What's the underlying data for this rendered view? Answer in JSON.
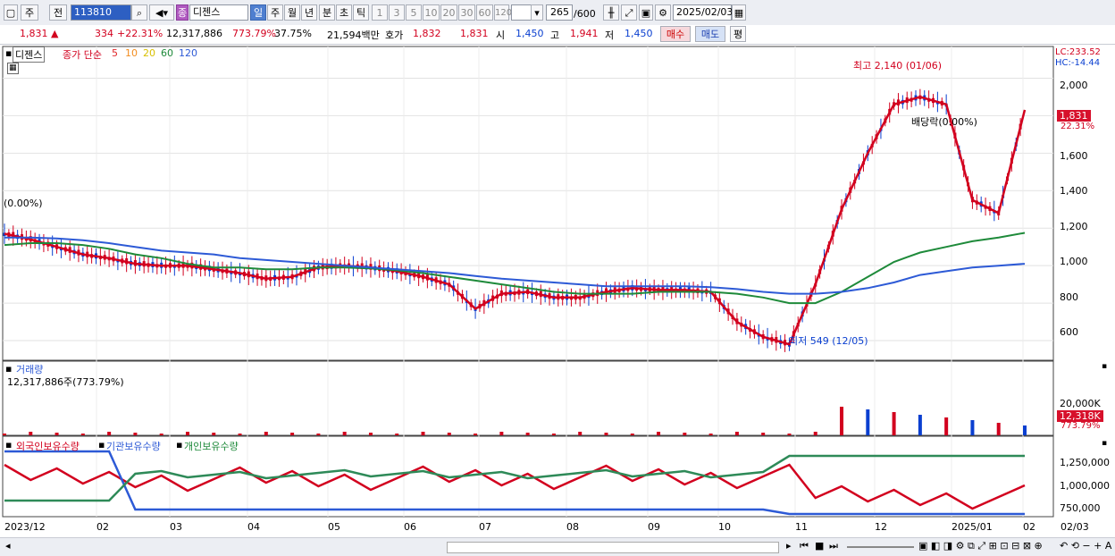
{
  "toolbar": {
    "period_ju": "주",
    "jeon": "전",
    "code": "113810",
    "name_badge": "종",
    "name": "디젠스",
    "periods": [
      "일",
      "주",
      "월",
      "년",
      "분",
      "초",
      "틱"
    ],
    "mins": [
      "1",
      "3",
      "5",
      "10",
      "20",
      "30",
      "60",
      "120"
    ],
    "count": "265",
    "count_max": "/600",
    "date": "2025/02/03"
  },
  "quote": {
    "price": "1,831 ▲",
    "change": "334",
    "change_pct": "+22.31%",
    "volume": "12,317,886",
    "vol_pct": "773.79%",
    "turnover": "37.75%",
    "amount": "21,594백만",
    "hoga_label": "호가",
    "hoga_sell": "1,832",
    "hoga_buy": "1,831",
    "open_label": "시",
    "open": "1,450",
    "high_label": "고",
    "high": "1,941",
    "low_label": "저",
    "low": "1,450",
    "buy_btn": "매수",
    "sell_btn": "매도",
    "eval_btn": "평"
  },
  "price_panel": {
    "name": "디젠스",
    "ma_label": "종가 단순",
    "ma_periods": [
      "5",
      "10",
      "20",
      "60",
      "120"
    ],
    "ma_colors": [
      "#e0262a",
      "#f28c1e",
      "#f0d81c",
      "#1e8a3a",
      "#2d5ad6"
    ],
    "lc": "LC:233.52",
    "hc": "HC:-14.44",
    "zero_pct": "(0.00%)",
    "high_note": "최고 2,140 (01/06)",
    "low_note": "최저 549 (12/05)",
    "div_note": "배당락(0.00%)",
    "last_price": "1,831",
    "last_pct": "22.31%",
    "y_ticks": [
      "2,000",
      "1,800",
      "1,600",
      "1,400",
      "1,200",
      "1,000",
      "800",
      "600"
    ]
  },
  "volume_panel": {
    "title": "거래량",
    "value": "12,317,886주(773.79%)",
    "tick": "20,000K",
    "last": "12,318K",
    "last_pct": "773.79%"
  },
  "holding_panel": {
    "foreign": "외국인보유수량",
    "inst": "기관보유수량",
    "indiv": "개인보유수량",
    "ticks": [
      "1,250,000",
      "1,000,000",
      "750,000"
    ]
  },
  "x_labels": [
    "2023/12",
    "02",
    "03",
    "04",
    "05",
    "06",
    "07",
    "08",
    "09",
    "10",
    "11",
    "12",
    "2025/01",
    "02",
    "02/03"
  ],
  "chart_data": {
    "type": "line",
    "series": [
      {
        "name": "종가",
        "color": "#d2001e",
        "values": [
          1170,
          1140,
          1100,
          1060,
          1040,
          1010,
          1000,
          1000,
          980,
          960,
          930,
          940,
          990,
          1000,
          990,
          970,
          940,
          900,
          770,
          850,
          860,
          830,
          830,
          860,
          880,
          870,
          870,
          860,
          700,
          620,
          580,
          900,
          1300,
          1600,
          1860,
          1900,
          1860,
          1350,
          1280,
          1831
        ]
      },
      {
        "name": "MA60",
        "color": "#1e8a3a",
        "values": [
          1110,
          1120,
          1120,
          1110,
          1090,
          1060,
          1040,
          1010,
          990,
          990,
          980,
          980,
          990,
          990,
          985,
          975,
          960,
          940,
          920,
          900,
          880,
          860,
          850,
          850,
          850,
          860,
          860,
          860,
          850,
          830,
          800,
          800,
          860,
          940,
          1020,
          1070,
          1100,
          1130,
          1150,
          1175
        ]
      },
      {
        "name": "MA120",
        "color": "#2d5ad6",
        "values": [
          1150,
          1150,
          1145,
          1135,
          1120,
          1100,
          1080,
          1070,
          1060,
          1040,
          1030,
          1020,
          1010,
          1000,
          990,
          980,
          970,
          960,
          945,
          930,
          920,
          910,
          900,
          890,
          890,
          890,
          890,
          885,
          875,
          860,
          850,
          850,
          860,
          880,
          910,
          950,
          970,
          990,
          1000,
          1010
        ]
      }
    ],
    "ylim": [
      500,
      2150
    ]
  }
}
